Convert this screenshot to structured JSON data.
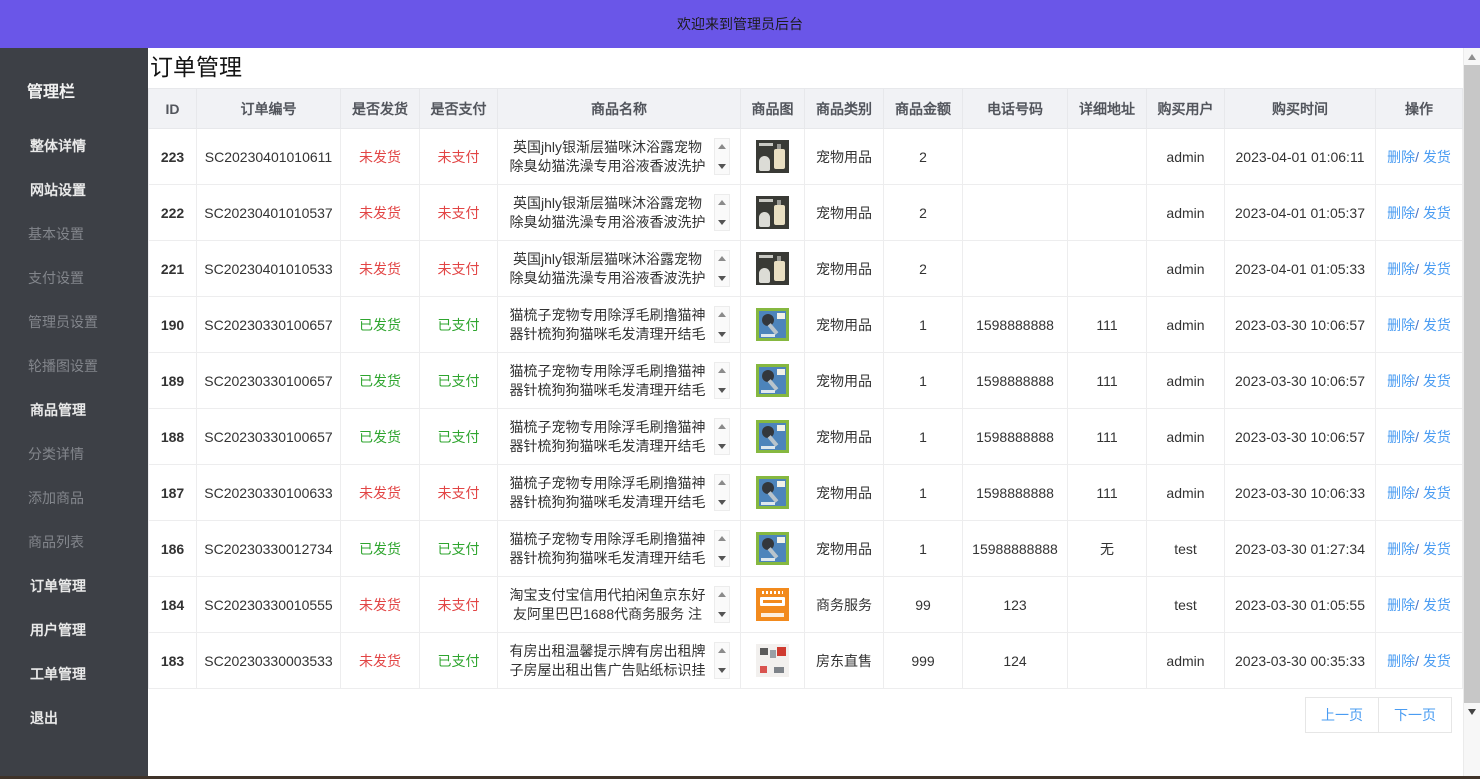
{
  "banner": {
    "title": "欢迎来到管理员后台"
  },
  "sidebar": {
    "header": "管理栏",
    "items": [
      {
        "label": "整体详情",
        "bright": true
      },
      {
        "label": "网站设置",
        "bright": true
      },
      {
        "label": "基本设置",
        "bright": false
      },
      {
        "label": "支付设置",
        "bright": false
      },
      {
        "label": "管理员设置",
        "bright": false
      },
      {
        "label": "轮播图设置",
        "bright": false
      },
      {
        "label": "商品管理",
        "bright": true
      },
      {
        "label": "分类详情",
        "bright": false
      },
      {
        "label": "添加商品",
        "bright": false
      },
      {
        "label": "商品列表",
        "bright": false
      },
      {
        "label": "订单管理",
        "bright": true
      },
      {
        "label": "用户管理",
        "bright": true
      },
      {
        "label": "工单管理",
        "bright": true
      },
      {
        "label": "退出",
        "bright": true
      }
    ]
  },
  "page": {
    "title": "订单管理"
  },
  "table": {
    "columns": [
      "ID",
      "订单编号",
      "是否发货",
      "是否支付",
      "商品名称",
      "商品图",
      "商品类别",
      "商品金额",
      "电话号码",
      "详细地址",
      "购买用户",
      "购买时间",
      "操作"
    ],
    "actions": {
      "delete": "删除",
      "ship": "发货"
    },
    "rows": [
      {
        "id": "223",
        "order_no": "SC20230401010611",
        "shipped": "未发货",
        "shipped_state": "no",
        "paid": "未支付",
        "paid_state": "no",
        "product_name": "英国jhly银渐层猫咪沐浴露宠物除臭幼猫洗澡专用浴液香波洗护",
        "image": "shampoo",
        "category": "宠物用品",
        "amount": "2",
        "phone": "",
        "address": "",
        "buyer": "admin",
        "time": "2023-04-01 01:06:11"
      },
      {
        "id": "222",
        "order_no": "SC20230401010537",
        "shipped": "未发货",
        "shipped_state": "no",
        "paid": "未支付",
        "paid_state": "no",
        "product_name": "英国jhly银渐层猫咪沐浴露宠物除臭幼猫洗澡专用浴液香波洗护",
        "image": "shampoo",
        "category": "宠物用品",
        "amount": "2",
        "phone": "",
        "address": "",
        "buyer": "admin",
        "time": "2023-04-01 01:05:37"
      },
      {
        "id": "221",
        "order_no": "SC20230401010533",
        "shipped": "未发货",
        "shipped_state": "no",
        "paid": "未支付",
        "paid_state": "no",
        "product_name": "英国jhly银渐层猫咪沐浴露宠物除臭幼猫洗澡专用浴液香波洗护",
        "image": "shampoo",
        "category": "宠物用品",
        "amount": "2",
        "phone": "",
        "address": "",
        "buyer": "admin",
        "time": "2023-04-01 01:05:33"
      },
      {
        "id": "190",
        "order_no": "SC20230330100657",
        "shipped": "已发货",
        "shipped_state": "yes",
        "paid": "已支付",
        "paid_state": "yes",
        "product_name": "猫梳子宠物专用除浮毛刷撸猫神器针梳狗狗猫咪毛发清理开结毛",
        "image": "brush",
        "category": "宠物用品",
        "amount": "1",
        "phone": "1598888888",
        "address": "111",
        "buyer": "admin",
        "time": "2023-03-30 10:06:57"
      },
      {
        "id": "189",
        "order_no": "SC20230330100657",
        "shipped": "已发货",
        "shipped_state": "yes",
        "paid": "已支付",
        "paid_state": "yes",
        "product_name": "猫梳子宠物专用除浮毛刷撸猫神器针梳狗狗猫咪毛发清理开结毛",
        "image": "brush",
        "category": "宠物用品",
        "amount": "1",
        "phone": "1598888888",
        "address": "111",
        "buyer": "admin",
        "time": "2023-03-30 10:06:57"
      },
      {
        "id": "188",
        "order_no": "SC20230330100657",
        "shipped": "已发货",
        "shipped_state": "yes",
        "paid": "已支付",
        "paid_state": "yes",
        "product_name": "猫梳子宠物专用除浮毛刷撸猫神器针梳狗狗猫咪毛发清理开结毛",
        "image": "brush",
        "category": "宠物用品",
        "amount": "1",
        "phone": "1598888888",
        "address": "111",
        "buyer": "admin",
        "time": "2023-03-30 10:06:57"
      },
      {
        "id": "187",
        "order_no": "SC20230330100633",
        "shipped": "未发货",
        "shipped_state": "no",
        "paid": "未支付",
        "paid_state": "no",
        "product_name": "猫梳子宠物专用除浮毛刷撸猫神器针梳狗狗猫咪毛发清理开结毛",
        "image": "brush",
        "category": "宠物用品",
        "amount": "1",
        "phone": "1598888888",
        "address": "111",
        "buyer": "admin",
        "time": "2023-03-30 10:06:33"
      },
      {
        "id": "186",
        "order_no": "SC20230330012734",
        "shipped": "已发货",
        "shipped_state": "yes",
        "paid": "已支付",
        "paid_state": "yes",
        "product_name": "猫梳子宠物专用除浮毛刷撸猫神器针梳狗狗猫咪毛发清理开结毛",
        "image": "brush",
        "category": "宠物用品",
        "amount": "1",
        "phone": "15988888888",
        "address": "无",
        "buyer": "test",
        "time": "2023-03-30 01:27:34"
      },
      {
        "id": "184",
        "order_no": "SC20230330010555",
        "shipped": "未发货",
        "shipped_state": "no",
        "paid": "未支付",
        "paid_state": "no",
        "product_name": "淘宝支付宝信用代拍闲鱼京东好友阿里巴巴1688代商务服务 注",
        "image": "orange",
        "category": "商务服务",
        "amount": "99",
        "phone": "123",
        "address": "",
        "buyer": "test",
        "time": "2023-03-30 01:05:55"
      },
      {
        "id": "183",
        "order_no": "SC20230330003533",
        "shipped": "未发货",
        "shipped_state": "no",
        "paid": "已支付",
        "paid_state": "yes",
        "product_name": "有房出租温馨提示牌有房出租牌子房屋出租出售广告贴纸标识挂",
        "image": "rental",
        "category": "房东直售",
        "amount": "999",
        "phone": "124",
        "address": "",
        "buyer": "admin",
        "time": "2023-03-30 00:35:33"
      }
    ]
  },
  "pagination": {
    "prev": "上一页",
    "next": "下一页"
  },
  "colors": {
    "accent": "#6a56e8",
    "danger": "#e24545",
    "success": "#2fa52f",
    "link": "#4a9cf2",
    "sidebar_bg": "#3d4046"
  }
}
